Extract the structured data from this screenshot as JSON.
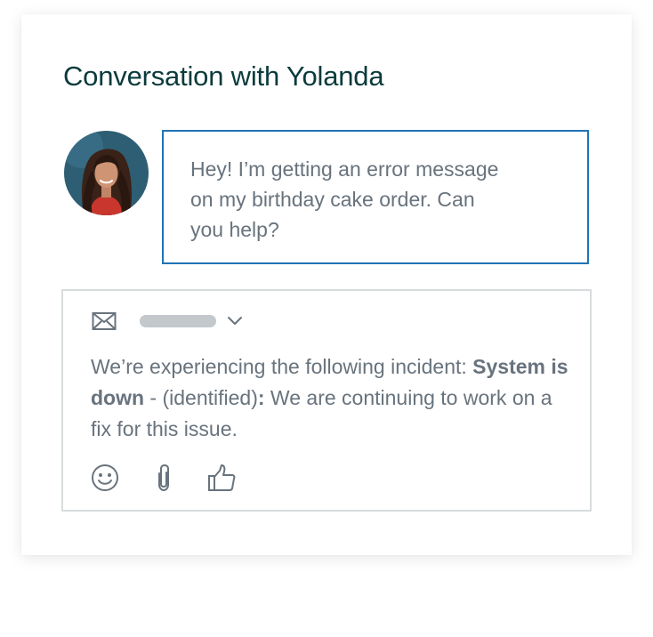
{
  "conversation": {
    "title": "Conversation with Yolanda"
  },
  "incoming_message": {
    "text": "Hey! I’m getting an error message\non my birthday cake order. Can\nyou help?"
  },
  "composer": {
    "channel_icon": "mail-icon",
    "reply": {
      "intro": "We’re experiencing the following incident:",
      "incident_name": "System is down",
      "separator": " - (identified)",
      "colon": ":",
      "detail": " We are continuing to work on a fix for this issue."
    },
    "toolbar_icons": [
      "smiley-icon",
      "paperclip-icon",
      "thumbs-up-icon"
    ]
  },
  "colors": {
    "title": "#0b3b3c",
    "accent_border": "#1f73b7",
    "body_text": "#68737d",
    "composer_border": "#d8dcde",
    "icon": "#68737d",
    "placeholder_pill": "#c2c8cc"
  }
}
